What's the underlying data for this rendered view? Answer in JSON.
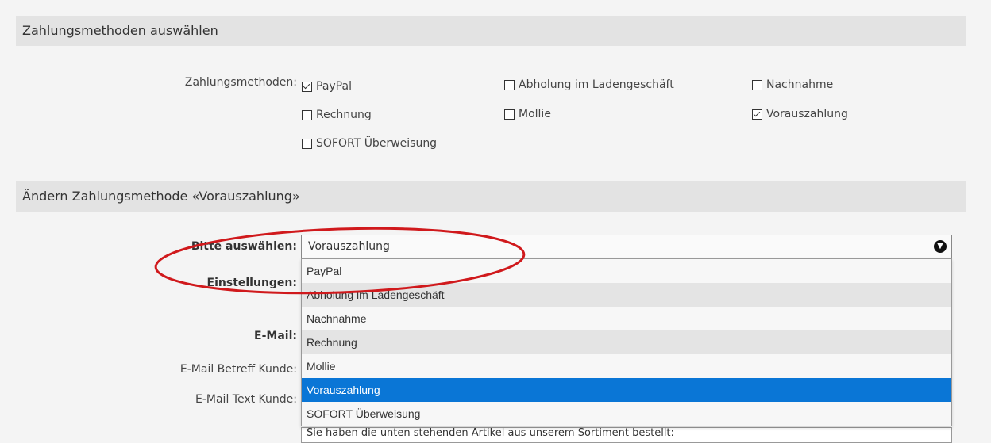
{
  "section1": {
    "title": "Zahlungsmethoden auswählen"
  },
  "payment_methods": {
    "label": "Zahlungsmethoden:",
    "options": [
      {
        "label": "PayPal",
        "checked": true
      },
      {
        "label": "Abholung im Ladengeschäft",
        "checked": false
      },
      {
        "label": "Nachnahme",
        "checked": false
      },
      {
        "label": "Rechnung",
        "checked": false
      },
      {
        "label": "Mollie",
        "checked": false
      },
      {
        "label": "Vorauszahlung",
        "checked": true
      },
      {
        "label": "SOFORT Überweisung",
        "checked": false
      }
    ]
  },
  "section2": {
    "title": "Ändern Zahlungsmethode «Vorauszahlung»"
  },
  "form": {
    "select_label": "Bitte auswählen:",
    "select_value": "Vorauszahlung",
    "settings_label": "Einstellungen:",
    "email_label": "E-Mail:",
    "email_subject_label": "E-Mail Betreff Kunde:",
    "email_text_label": "E-Mail Text Kunde:",
    "email_text_value": "Sie haben die unten stehenden Artikel aus unserem Sortiment bestellt:"
  },
  "dropdown": {
    "options": [
      "PayPal",
      "Abholung im Ladengeschäft",
      "Nachnahme",
      "Rechnung",
      "Mollie",
      "Vorauszahlung",
      "SOFORT Überweisung"
    ],
    "selected": "Vorauszahlung"
  },
  "colors": {
    "highlight": "#0a76d6",
    "annotation": "#d0191c",
    "header_bg": "#e3e3e3"
  },
  "icons": {
    "select_toggle": "chevron-down-circle-icon"
  }
}
